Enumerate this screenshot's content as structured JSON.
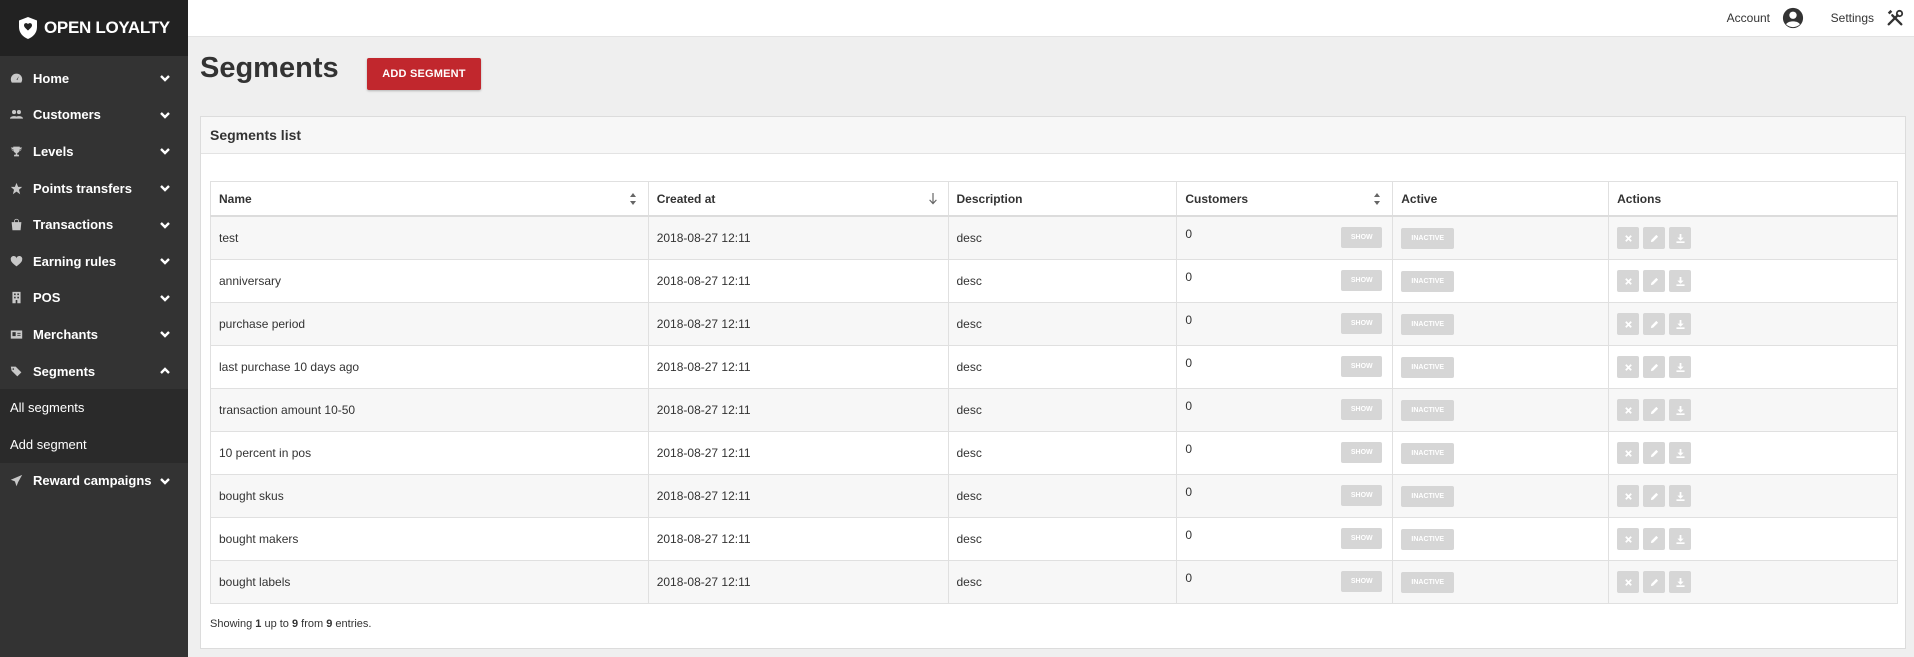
{
  "brand": {
    "name": "OPEN LOYALTY"
  },
  "topbar": {
    "account_label": "Account",
    "settings_label": "Settings"
  },
  "sidebar": {
    "items": [
      {
        "label": "Home",
        "icon": "dashboard-icon"
      },
      {
        "label": "Customers",
        "icon": "users-icon"
      },
      {
        "label": "Levels",
        "icon": "trophy-icon"
      },
      {
        "label": "Points transfers",
        "icon": "star-icon"
      },
      {
        "label": "Transactions",
        "icon": "shopping-bag-icon"
      },
      {
        "label": "Earning rules",
        "icon": "heart-icon"
      },
      {
        "label": "POS",
        "icon": "building-icon"
      },
      {
        "label": "Merchants",
        "icon": "id-card-icon"
      },
      {
        "label": "Segments",
        "icon": "tags-icon"
      }
    ],
    "submenu": [
      "All segments",
      "Add segment"
    ],
    "last_item": {
      "label": "Reward campaigns",
      "icon": "paper-plane-icon"
    }
  },
  "page": {
    "title": "Segments",
    "add_button": "ADD SEGMENT"
  },
  "card": {
    "title": "Segments list"
  },
  "table": {
    "columns": [
      "Name",
      "Created at",
      "Description",
      "Customers",
      "Active",
      "Actions"
    ],
    "show_label": "SHOW",
    "inactive_label": "INACTIVE",
    "rows": [
      {
        "name": "test",
        "created": "2018-08-27 12:11",
        "desc": "desc",
        "customers": "0"
      },
      {
        "name": "anniversary",
        "created": "2018-08-27 12:11",
        "desc": "desc",
        "customers": "0"
      },
      {
        "name": "purchase period",
        "created": "2018-08-27 12:11",
        "desc": "desc",
        "customers": "0"
      },
      {
        "name": "last purchase 10 days ago",
        "created": "2018-08-27 12:11",
        "desc": "desc",
        "customers": "0"
      },
      {
        "name": "transaction amount 10-50",
        "created": "2018-08-27 12:11",
        "desc": "desc",
        "customers": "0"
      },
      {
        "name": "10 percent in pos",
        "created": "2018-08-27 12:11",
        "desc": "desc",
        "customers": "0"
      },
      {
        "name": "bought skus",
        "created": "2018-08-27 12:11",
        "desc": "desc",
        "customers": "0"
      },
      {
        "name": "bought makers",
        "created": "2018-08-27 12:11",
        "desc": "desc",
        "customers": "0"
      },
      {
        "name": "bought labels",
        "created": "2018-08-27 12:11",
        "desc": "desc",
        "customers": "0"
      }
    ]
  },
  "footer": {
    "prefix": "Showing ",
    "from": "1",
    "mid1": " up to ",
    "to": "9",
    "mid2": " from ",
    "total": "9",
    "suffix": " entries."
  },
  "colors": {
    "sidebar_bg": "#333333",
    "accent": "#c1272d",
    "muted_button": "#d6d6d6"
  }
}
